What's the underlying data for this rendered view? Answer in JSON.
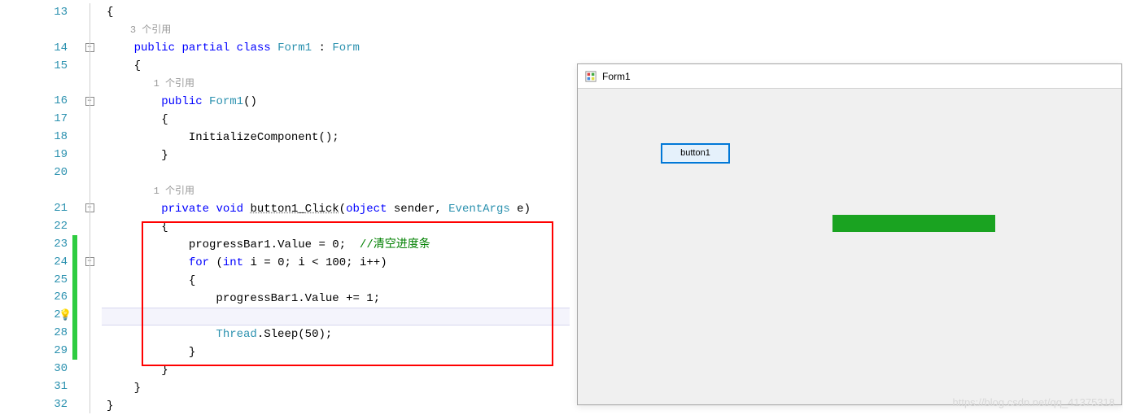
{
  "editor": {
    "lines": [
      "13",
      "14",
      "15",
      "16",
      "17",
      "18",
      "19",
      "20",
      "21",
      "22",
      "23",
      "24",
      "25",
      "26",
      "27",
      "28",
      "29",
      "30",
      "31",
      "32"
    ],
    "ref_hint": "个引用",
    "ref_count": {
      "class": "3",
      "ctor": "1",
      "click": "1"
    },
    "tokens": {
      "public": "public",
      "partial": "partial",
      "class": "class",
      "Form1": "Form1",
      "Form": "Form",
      "lparen": "(",
      "rparen": ")",
      "lbrace": "{",
      "rbrace": "}",
      "InitializeComponent": "InitializeComponent",
      "semi": ";",
      "private": "private",
      "void": "void",
      "button1_Click": "button1_Click",
      "object": "object",
      "sender": "sender",
      "comma": ",",
      "EventArgs": "EventArgs",
      "e": "e",
      "progressBar1": "progressBar1",
      "dot": ".",
      "Value": "Value",
      "eq": " = ",
      "zero": "0",
      "comment_clear": "//清空进度条",
      "for": "for",
      "int": "int",
      "i": "i",
      "lt": " < ",
      "hundred": "100",
      "ipp": "i++",
      "pluseq": " += ",
      "one": "1",
      "Thread": "Thread",
      "Sleep": "Sleep",
      "fifty": "50",
      "colon": " : "
    }
  },
  "form": {
    "title": "Form1",
    "button_label": "button1"
  },
  "watermark": "https://blog.csdn.net/qq_41375318"
}
